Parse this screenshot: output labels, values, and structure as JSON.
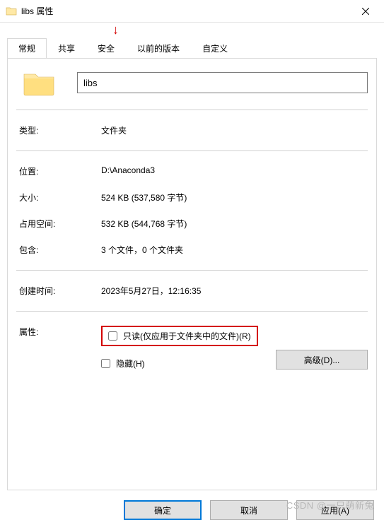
{
  "title": "libs 属性",
  "tabs": [
    {
      "label": "常规"
    },
    {
      "label": "共享"
    },
    {
      "label": "安全"
    },
    {
      "label": "以前的版本"
    },
    {
      "label": "自定义"
    }
  ],
  "name": "libs",
  "properties": {
    "type_label": "类型:",
    "type_value": "文件夹",
    "location_label": "位置:",
    "location_value": "D:\\Anaconda3",
    "size_label": "大小:",
    "size_value": "524 KB (537,580 字节)",
    "sizeondisk_label": "占用空间:",
    "sizeondisk_value": "532 KB (544,768 字节)",
    "contains_label": "包含:",
    "contains_value": "3 个文件，0 个文件夹",
    "created_label": "创建时间:",
    "created_value": "2023年5月27日，12:16:35"
  },
  "attributes": {
    "label": "属性:",
    "readonly": "只读(仅应用于文件夹中的文件)(R)",
    "hidden": "隐藏(H)",
    "advanced": "高级(D)..."
  },
  "buttons": {
    "ok": "确定",
    "cancel": "取消",
    "apply": "应用(A)"
  },
  "watermark": "CSDN @一只萌新兔"
}
